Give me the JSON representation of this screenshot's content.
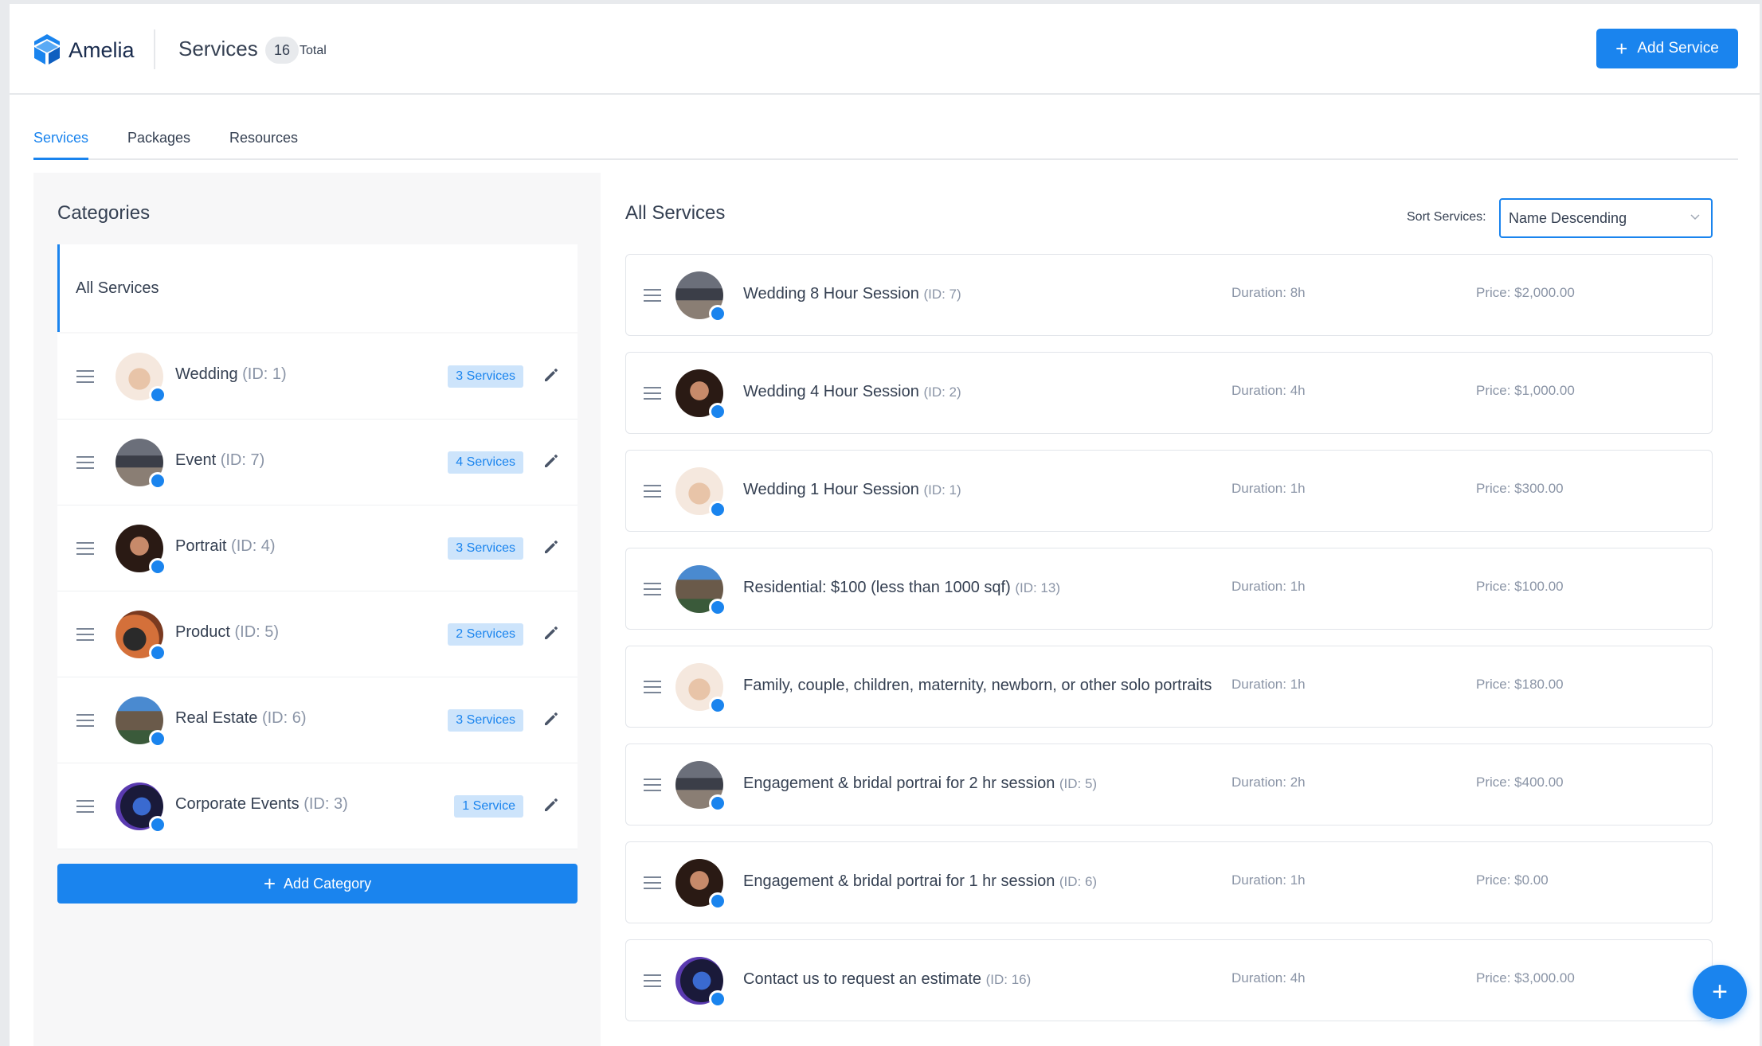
{
  "app": {
    "brand": "Amelia"
  },
  "header": {
    "title": "Services",
    "count": "16",
    "count_label": "Total",
    "add_button": "Add Service"
  },
  "tabs": [
    {
      "label": "Services",
      "active": true
    },
    {
      "label": "Packages",
      "active": false
    },
    {
      "label": "Resources",
      "active": false
    }
  ],
  "categories": {
    "title": "Categories",
    "all_label": "All Services",
    "items": [
      {
        "name": "Wedding",
        "id": "(ID: 1)",
        "badge": "3 Services",
        "image": "wedding-hands"
      },
      {
        "name": "Event",
        "id": "(ID: 7)",
        "badge": "4 Services",
        "image": "event-hall"
      },
      {
        "name": "Portrait",
        "id": "(ID: 4)",
        "badge": "3 Services",
        "image": "portrait-woman"
      },
      {
        "name": "Product",
        "id": "(ID: 5)",
        "badge": "2 Services",
        "image": "product-watch"
      },
      {
        "name": "Real Estate",
        "id": "(ID: 6)",
        "badge": "3 Services",
        "image": "house"
      },
      {
        "name": "Corporate Events",
        "id": "(ID: 3)",
        "badge": "1 Service",
        "image": "corporate-stage"
      }
    ],
    "add_button": "Add Category"
  },
  "services": {
    "title": "All Services",
    "sort_label": "Sort Services:",
    "sort_value": "Name Descending",
    "items": [
      {
        "name": "Wedding 8 Hour Session",
        "id": "(ID: 7)",
        "duration": "Duration: 8h",
        "price": "Price: $2,000.00"
      },
      {
        "name": "Wedding 4 Hour Session",
        "id": "(ID: 2)",
        "duration": "Duration: 4h",
        "price": "Price: $1,000.00"
      },
      {
        "name": "Wedding 1 Hour Session",
        "id": "(ID: 1)",
        "duration": "Duration: 1h",
        "price": "Price: $300.00"
      },
      {
        "name": "Residential: $100 (less than 1000 sqf)",
        "id": "(ID: 13)",
        "duration": "Duration: 1h",
        "price": "Price: $100.00"
      },
      {
        "name": "Family, couple, children, maternity, newborn, or other solo portraits",
        "id": "",
        "duration": "Duration: 1h",
        "price": "Price: $180.00"
      },
      {
        "name": "Engagement & bridal portrai for 2 hr session",
        "id": "(ID: 5)",
        "duration": "Duration: 2h",
        "price": "Price: $400.00"
      },
      {
        "name": "Engagement & bridal portrai for 1 hr session",
        "id": "(ID: 6)",
        "duration": "Duration: 1h",
        "price": "Price: $0.00"
      },
      {
        "name": "Contact us to request an estimate",
        "id": "(ID: 16)",
        "duration": "Duration: 4h",
        "price": "Price: $3,000.00"
      }
    ]
  },
  "fab_label": "+",
  "colors": {
    "accent": "#1a84ee",
    "badge_bg": "#cde4fb",
    "text": "#354052",
    "muted": "#8a94a6"
  }
}
